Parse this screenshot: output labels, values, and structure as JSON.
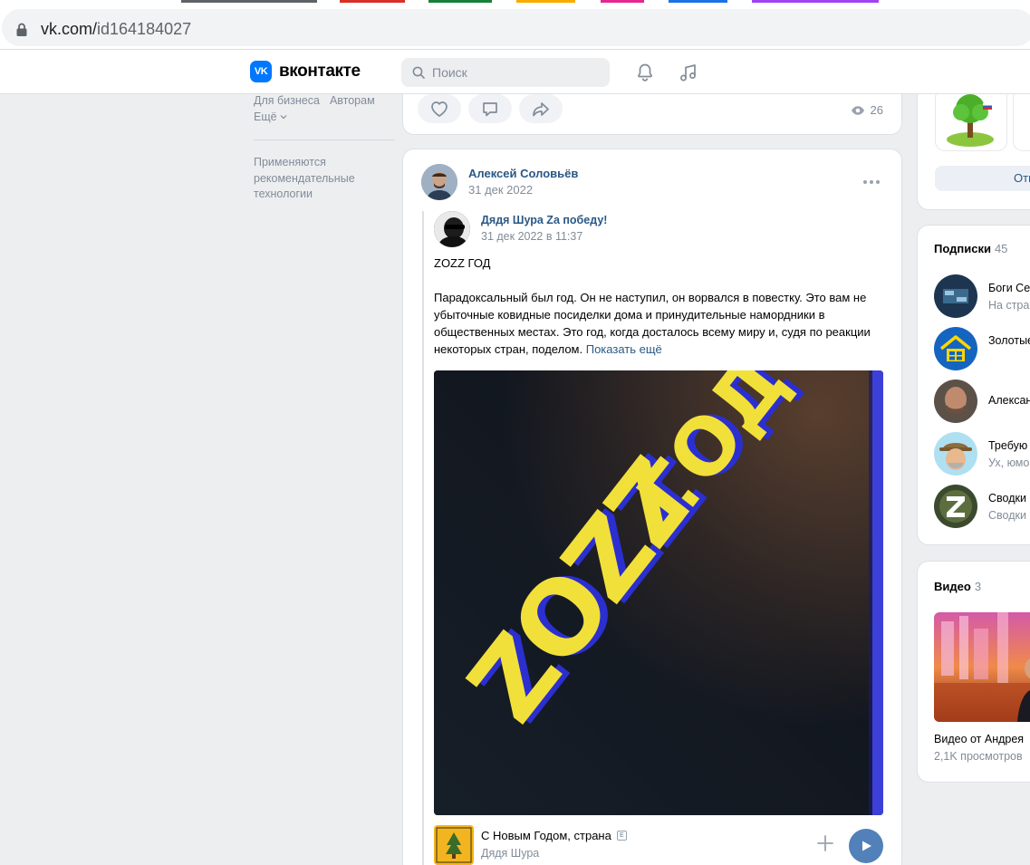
{
  "browser": {
    "url_host": "vk.com/",
    "url_path": "id164184027"
  },
  "header": {
    "logo_text": "вконтакте",
    "logo_mark": "VK",
    "search_placeholder": "Поиск"
  },
  "left_menu": {
    "links": [
      "Для бизнеса",
      "Авторам"
    ],
    "more_label": "Ещё",
    "note": "Применяются рекомендательные технологии"
  },
  "prev_post": {
    "views": "26"
  },
  "post": {
    "author": "Алексей Соловьёв",
    "date": "31 дек 2022",
    "repost": {
      "author": "Дядя Шура Za победу!",
      "date": "31 дек 2022 в 11:37",
      "title": "ZOZZ ГОД",
      "text": "Парадоксальный был год. Он не наступил, он ворвался в повестку. Это вам не убыточные ковидные посиделки дома и принудительные намордники в общественных местах. Это год, когда досталось всему миру и, судя по реакции некоторых стран, поделом.",
      "show_more": "Показать ещё",
      "image_text": [
        "ZOZZ",
        "ГОД"
      ]
    },
    "audio": {
      "title": "С Новым Годом, страна",
      "explicit_mark": "E",
      "artist": "Дядя Шура"
    }
  },
  "right": {
    "button_label": "Отп",
    "subscriptions": {
      "title": "Подписки",
      "count": "45",
      "items": [
        {
          "name": "Боги Се",
          "desc": "На стра"
        },
        {
          "name": "Золотые",
          "desc": ""
        },
        {
          "name": "Алексан",
          "desc": ""
        },
        {
          "name": "Требую",
          "desc": "Ух, юмо"
        },
        {
          "name": "Сводки",
          "desc": "Сводки"
        }
      ]
    },
    "videos": {
      "title": "Видео",
      "count": "3",
      "item_title": "Видео от Андрея",
      "item_views": "2,1K просмотров"
    }
  },
  "colors": {
    "vk_blue": "#0077ff",
    "link": "#2a5885",
    "secondary_text": "#818c99",
    "play_button": "#5181b8",
    "page_bg": "#edeef0"
  }
}
